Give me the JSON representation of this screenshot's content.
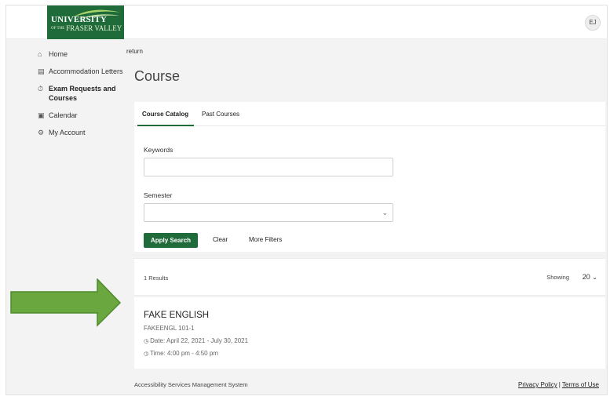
{
  "header": {
    "logo": {
      "line1": "UNIVERSITY",
      "line2_small": "OF THE",
      "line2": "FRASER VALLEY"
    },
    "avatar_initials": "EJ"
  },
  "sidebar": {
    "items": [
      {
        "label": "Home",
        "icon": "home-icon",
        "active": false
      },
      {
        "label": "Accommodation Letters",
        "icon": "document-icon",
        "active": false
      },
      {
        "label": "Exam Requests and Courses",
        "icon": "stopwatch-icon",
        "active": true
      },
      {
        "label": "Calendar",
        "icon": "calendar-icon",
        "active": false
      },
      {
        "label": "My Account",
        "icon": "gear-icon",
        "active": false
      }
    ]
  },
  "main": {
    "return_label": "return",
    "title": "Course",
    "tabs": [
      {
        "label": "Course Catalog",
        "active": true
      },
      {
        "label": "Past Courses",
        "active": false
      }
    ],
    "filters": {
      "keywords_label": "Keywords",
      "keywords_value": "",
      "semester_label": "Semester",
      "semester_value": "",
      "apply_label": "Apply Search",
      "clear_label": "Clear",
      "more_label": "More Filters"
    },
    "results": {
      "count_text": "1 Results",
      "showing_label": "Showing",
      "page_size": "20"
    },
    "courses": [
      {
        "name": "FAKE ENGLISH",
        "code": "FAKEENGL 101-1",
        "date": "Date: April 22, 2021 - July 30, 2021",
        "time": "Time: 4:00 pm - 4:50 pm"
      }
    ]
  },
  "footer": {
    "system_name": "Accessibility Services Management System",
    "privacy_label": "Privacy Policy",
    "separator": "|",
    "terms_label": "Terms of Use"
  },
  "colors": {
    "brand_green": "#1f6b3a",
    "arrow_green": "#6aa83f",
    "background": "#f3f3f3"
  }
}
